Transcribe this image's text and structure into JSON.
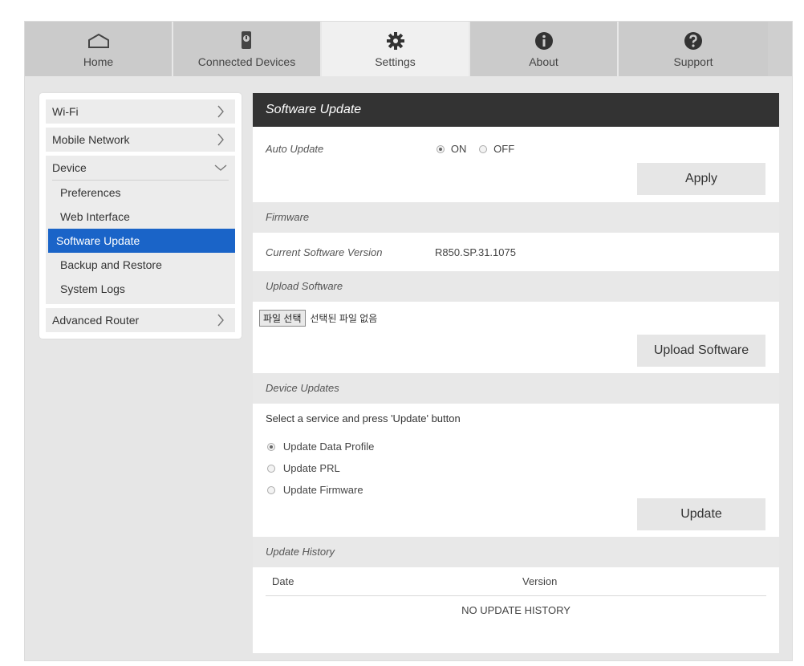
{
  "topnav": {
    "tabs": [
      {
        "label": "Home",
        "icon": "home-icon"
      },
      {
        "label": "Connected Devices",
        "icon": "connected-devices-icon"
      },
      {
        "label": "Settings",
        "icon": "gear-icon",
        "active": true
      },
      {
        "label": "About",
        "icon": "info-icon"
      },
      {
        "label": "Support",
        "icon": "question-icon"
      }
    ]
  },
  "sidebar": {
    "wifi": "Wi-Fi",
    "mobile_network": "Mobile Network",
    "device": "Device",
    "device_items": [
      "Preferences",
      "Web Interface",
      "Software Update",
      "Backup and Restore",
      "System Logs"
    ],
    "advanced_router": "Advanced Router"
  },
  "panel": {
    "title": "Software Update",
    "auto_update": {
      "label": "Auto Update",
      "on_label": "ON",
      "off_label": "OFF",
      "selected": "ON"
    },
    "apply_label": "Apply",
    "firmware_section": "Firmware",
    "current_version_label": "Current Software Version",
    "current_version_value": "R850.SP.31.1075",
    "upload_section": "Upload Software",
    "file_button": "파일 선택",
    "file_status": "선택된 파일 없음",
    "upload_button": "Upload Software",
    "device_updates_section": "Device Updates",
    "device_updates_instruction": "Select a service and press 'Update' button",
    "update_options": [
      "Update Data Profile",
      "Update PRL",
      "Update Firmware"
    ],
    "update_selected": "Update Data Profile",
    "update_button": "Update",
    "history_section": "Update History",
    "history_columns": [
      "Date",
      "Version"
    ],
    "history_empty": "NO UPDATE HISTORY"
  },
  "colors": {
    "accent_blue": "#1a64c8",
    "header_dark": "#333333",
    "nav_bg": "#cbcbcb"
  }
}
